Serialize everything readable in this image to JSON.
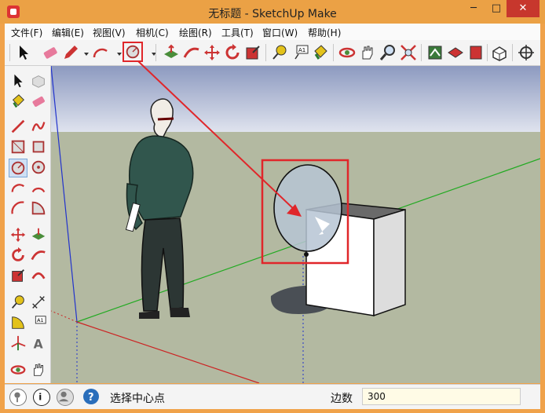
{
  "window": {
    "title": "无标题 - SketchUp Make",
    "minimize": "─",
    "maximize": "□",
    "close": "✕"
  },
  "menubar": {
    "items": [
      "文件(F)",
      "编辑(E)",
      "视图(V)",
      "相机(C)",
      "绘图(R)",
      "工具(T)",
      "窗口(W)",
      "帮助(H)"
    ]
  },
  "toolbar": {
    "tools": [
      "select-icon",
      "eraser-icon",
      "pencil-icon",
      "arc-icon",
      "circle-icon",
      "push-pull-icon",
      "follow-me-icon",
      "move-icon",
      "rotate-icon",
      "scale-icon",
      "tape-measure-icon",
      "text-icon",
      "paint-bucket-icon",
      "orbit-icon",
      "pan-icon",
      "zoom-icon",
      "zoom-extents-icon",
      "3d-warehouse-icon",
      "extension-warehouse-icon",
      "layout-icon",
      "components-icon",
      "position-camera-icon"
    ],
    "active_tool": "circle-icon"
  },
  "colors": {
    "sky": "#aab4cf",
    "ground": "#b2b9a0",
    "highlight": "#e0262a",
    "accent": "#2a6ebb"
  },
  "statusbar": {
    "status_text": "选择中心点",
    "measure_label": "边数",
    "measure_value": "300"
  }
}
